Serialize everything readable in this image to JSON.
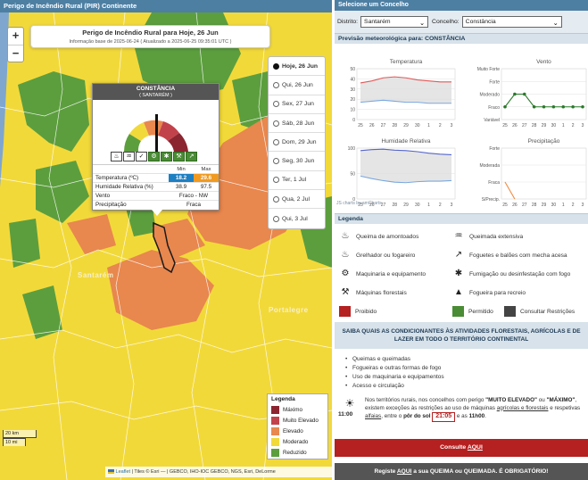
{
  "map": {
    "header": "Perigo de Incêndio Rural (PIR) Continente",
    "title": "Perigo de Incêndio Rural para Hoje, 26 Jun",
    "subtitle": "Informação base de 2025-06-24 ( Atualizado a 2025-06-25 09:35:01 UTC )",
    "zoom_in": "+",
    "zoom_out": "−",
    "place_labels": [
      "Santarém",
      "Portalegre"
    ],
    "days": [
      {
        "label": "Hoje, 26 Jun",
        "selected": true
      },
      {
        "label": "Qui, 26 Jun",
        "selected": false
      },
      {
        "label": "Sex, 27 Jun",
        "selected": false
      },
      {
        "label": "Sáb, 28 Jun",
        "selected": false
      },
      {
        "label": "Dom, 29 Jun",
        "selected": false
      },
      {
        "label": "Seg, 30 Jun",
        "selected": false
      },
      {
        "label": "Ter, 1 Jul",
        "selected": false
      },
      {
        "label": "Qua, 2 Jul",
        "selected": false
      },
      {
        "label": "Qui, 3 Jul",
        "selected": false
      }
    ],
    "popup": {
      "name": "CONSTÂNCIA",
      "district": "( SANTARÉM )",
      "col_min": "Min",
      "col_max": "Max",
      "temp_label": "Temperatura (ºC)",
      "temp_min": "18.2",
      "temp_max": "29.6",
      "hum_label": "Humidade Relativa (%)",
      "hum_min": "38.9",
      "hum_max": "97.5",
      "wind_label": "Vento",
      "wind_value": "Fraco - NW",
      "precip_label": "Precipitação",
      "precip_value": "Fraca"
    },
    "legend": {
      "title": "Legenda",
      "items": [
        {
          "label": "Máximo",
          "color": "#8b2530"
        },
        {
          "label": "Muito Elevado",
          "color": "#c2424b"
        },
        {
          "label": "Elevado",
          "color": "#e8874e"
        },
        {
          "label": "Moderado",
          "color": "#f2d93a"
        },
        {
          "label": "Reduzido",
          "color": "#5c9e3e"
        }
      ]
    },
    "scale_km": "20 km",
    "scale_mi": "10 mi",
    "attribution_leaflet": "Leaflet",
    "attribution_rest": "| Tiles © Esri — | GEBCO, IHO-IOC GEBCO, NGS, Esri, DeLorme"
  },
  "panel": {
    "header": "Selecione um Concelho",
    "district_label": "Distrito:",
    "district_value": "Santarém",
    "council_label": "Concelho:",
    "council_value": "Constância",
    "forecast_title": "Previsão meteorológica para: ",
    "forecast_place": "CONSTÂNCIA",
    "amcharts": "JS charts by amCharts",
    "legend_title": "Legenda",
    "legend_items": [
      {
        "label": "Queima de amontoados",
        "icon": "fire-pile-icon"
      },
      {
        "label": "Queimada extensiva",
        "icon": "fire-extensive-icon"
      },
      {
        "label": "Grelhador ou fogareiro",
        "icon": "grill-icon"
      },
      {
        "label": "Foguetes e balões com mecha acesa",
        "icon": "rocket-icon"
      },
      {
        "label": "Maquinaria e equipamento",
        "icon": "tractor-icon"
      },
      {
        "label": "Fumigação ou desinfestação com fogo",
        "icon": "fumigation-icon"
      },
      {
        "label": "Máquinas florestais",
        "icon": "forest-machine-icon"
      },
      {
        "label": "Fogueira para recreio",
        "icon": "campfire-icon"
      }
    ],
    "status_items": [
      {
        "label": "Proibido",
        "color": "#b52020"
      },
      {
        "label": "Permitido",
        "color": "#4a8c35"
      },
      {
        "label": "Consultar Restrições",
        "color": "#444444"
      }
    ],
    "info_heading": "SAIBA QUAIS AS CONDICIONANTES ÀS ATIVIDADES FLORESTAIS, AGRÍCOLAS E DE LAZER EM TODO O TERRITÓRIO CONTINENTAL",
    "bullets": [
      "Queimas e queimadas",
      "Fogueiras e outras formas de fogo",
      "Uso de maquinaria e equipamentos",
      "Acesso e circulação"
    ],
    "sun_time_label": "11:00",
    "sun_text_1": "Nos territórios rurais, nos concelhos com perigo ",
    "sun_text_level1": "\"MUITO ELEVADO\"",
    "sun_text_2": " ou ",
    "sun_text_level2": "\"MÁXIMO\"",
    "sun_text_3": ", existem exceções às restrições ao uso de máquinas ",
    "sun_text_u1": "agrícolas e florestais",
    "sun_text_4": " e respetivas ",
    "sun_text_u2": "alfaias",
    "sun_text_5": ", entre o ",
    "sun_text_sunset": "pôr do sol",
    "sun_text_time": "21:05",
    "sun_text_6": " e as ",
    "sun_text_end": "11h00",
    "sun_text_7": ".",
    "cta_consult_prefix": "Consulte ",
    "cta_consult_link": "AQUI",
    "cta_register_prefix": "Registe ",
    "cta_register_link": "AQUI",
    "cta_register_suffix": " a sua QUEIMA ou QUEIMADA. É OBRIGATÓRIO!"
  },
  "chart_data": [
    {
      "type": "line",
      "title": "Temperatura",
      "categories": [
        "25",
        "26",
        "27",
        "28",
        "29",
        "30",
        "1",
        "2",
        "3"
      ],
      "series": [
        {
          "values": [
            36,
            38,
            41,
            42,
            41,
            39,
            38,
            37,
            37
          ],
          "color": "#e05a5a"
        },
        {
          "values": [
            17,
            18,
            19,
            18,
            17,
            17,
            16,
            16,
            16
          ],
          "color": "#7aa8e0"
        }
      ],
      "ylim": [
        0,
        50
      ],
      "yticks": [
        "0",
        "10",
        "20",
        "30",
        "40",
        "50"
      ]
    },
    {
      "type": "line",
      "title": "Vento",
      "categories": [
        "25",
        "26",
        "27",
        "28",
        "29",
        "30",
        "1",
        "2",
        "3"
      ],
      "series": [
        {
          "values": [
            1,
            2,
            2,
            1,
            1,
            1,
            1,
            1,
            1
          ],
          "color": "#2a7a2a"
        }
      ],
      "ylim": [
        0,
        4
      ],
      "yticks": [
        "Variável",
        "Fraco",
        "Moderado",
        "Forte",
        "Muito Forte"
      ]
    },
    {
      "type": "area",
      "title": "Humidade Relativa",
      "categories": [
        "25",
        "26",
        "27",
        "28",
        "29",
        "30",
        "1",
        "2",
        "3"
      ],
      "series": [
        {
          "values": [
            95,
            97,
            98,
            96,
            95,
            93,
            90,
            88,
            87
          ],
          "color": "#5566cc"
        },
        {
          "values": [
            45,
            40,
            36,
            33,
            32,
            34,
            35,
            35,
            36
          ],
          "color": "#7aa8e0"
        }
      ],
      "ylim": [
        0,
        100
      ],
      "yticks": [
        "0",
        "50",
        "100"
      ]
    },
    {
      "type": "line",
      "title": "Precipitação",
      "categories": [
        "25",
        "26",
        "27",
        "28",
        "29",
        "30",
        "1",
        "2",
        "3"
      ],
      "series": [
        {
          "values": [
            1,
            0,
            0,
            0,
            0,
            0,
            0,
            0,
            0
          ],
          "color": "#f08a40"
        }
      ],
      "ylim": [
        0,
        3
      ],
      "yticks": [
        "S/Precip.",
        "Fraca",
        "Moderada",
        "Forte"
      ]
    }
  ]
}
